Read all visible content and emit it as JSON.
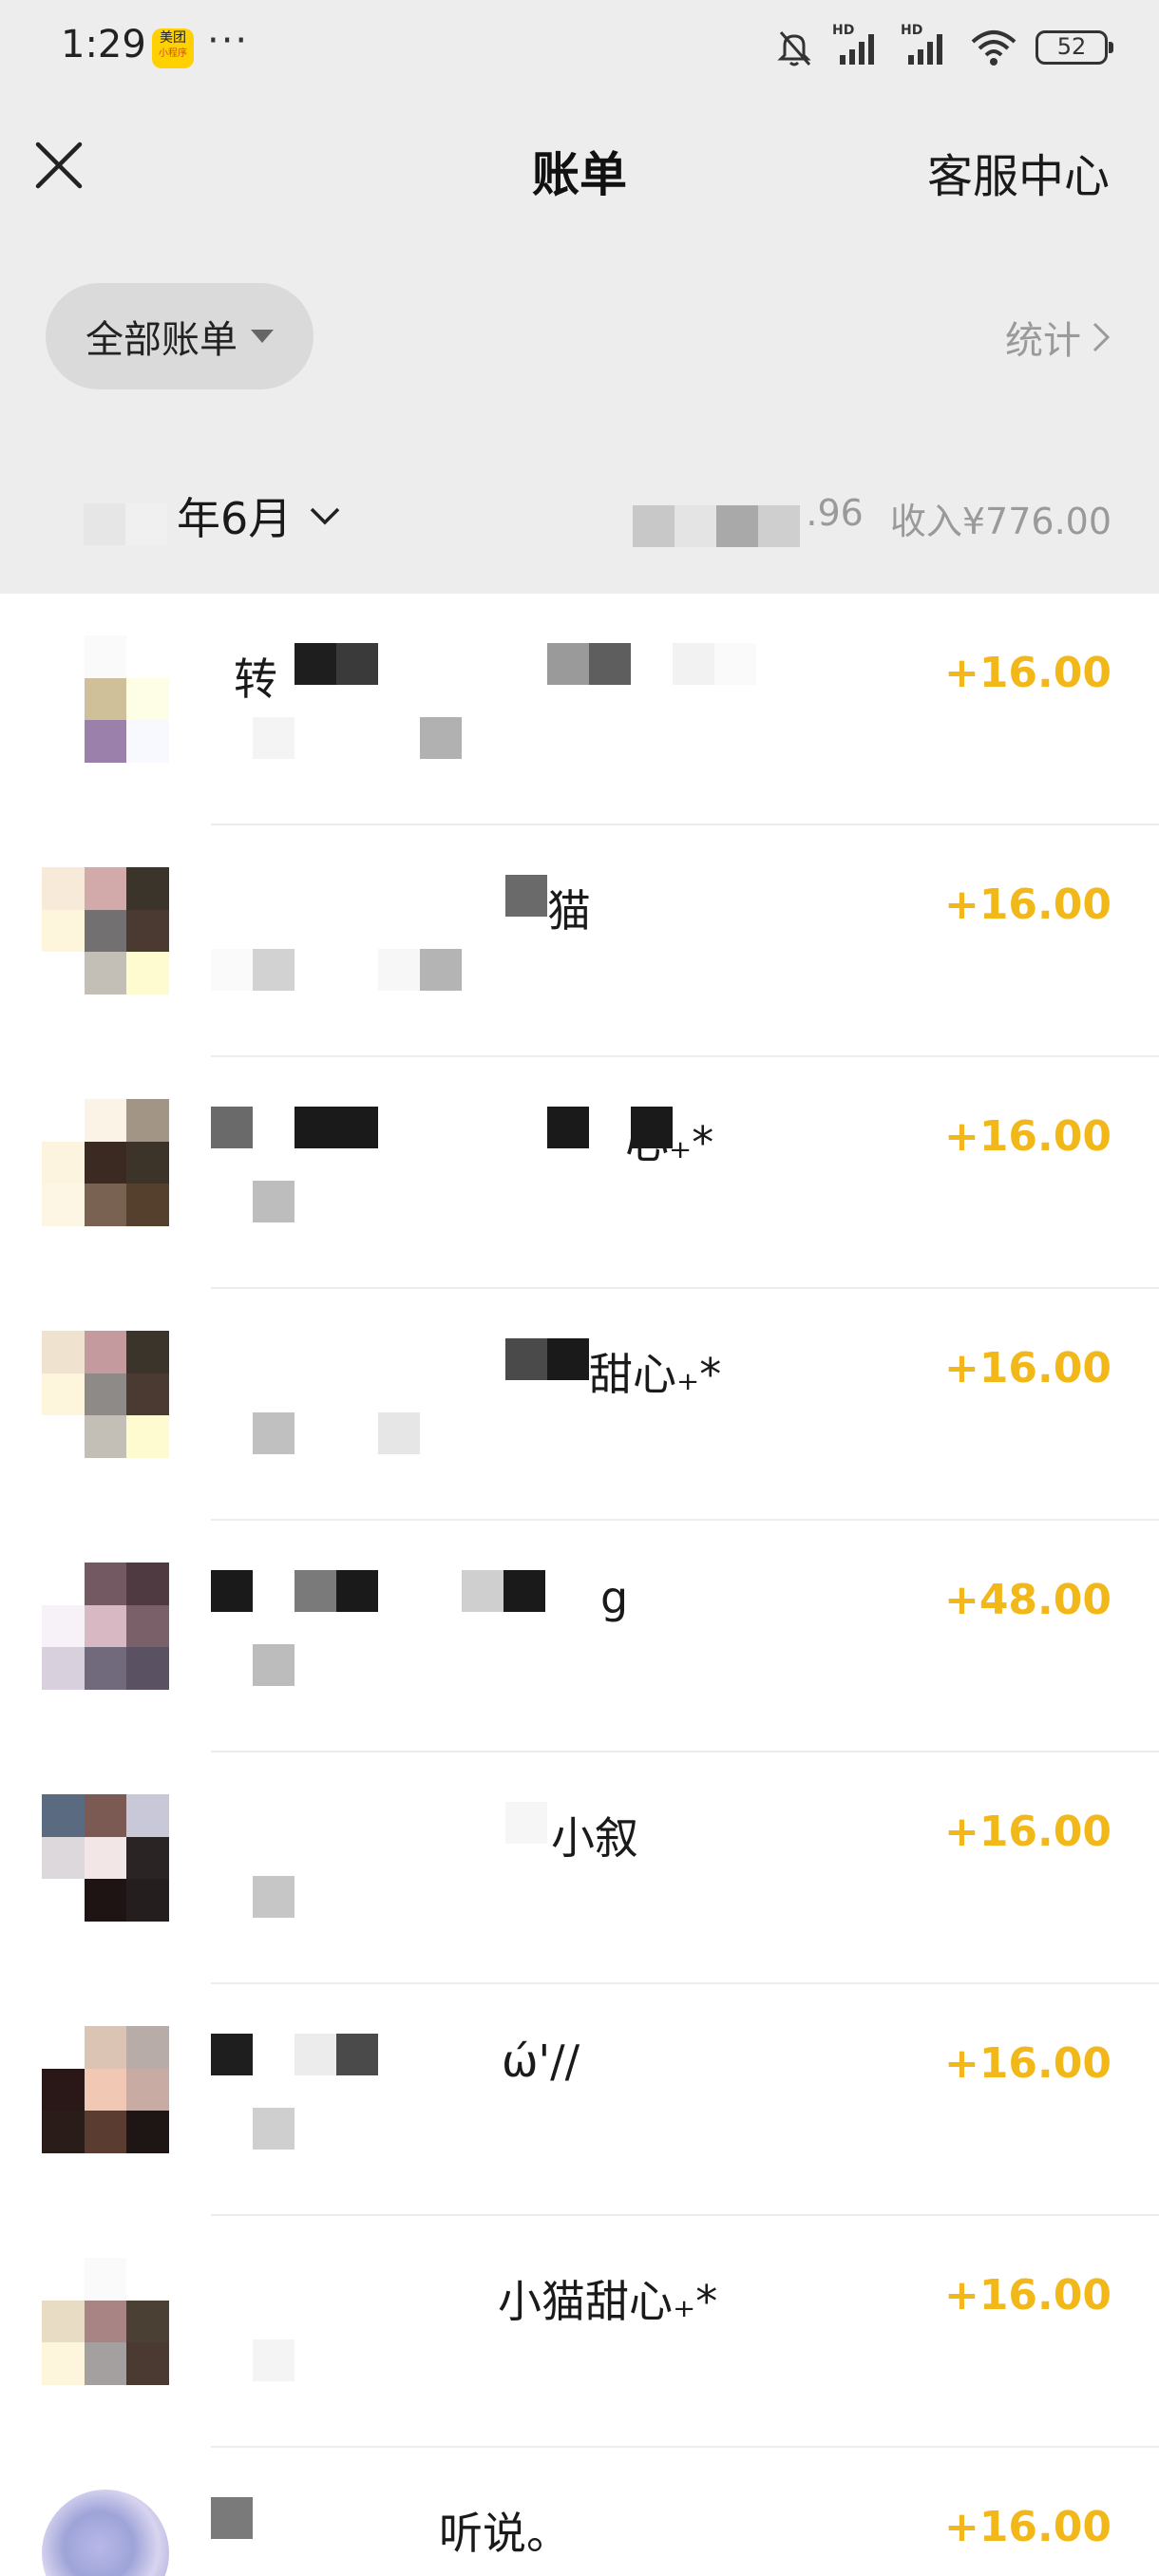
{
  "status_bar": {
    "time": "1:29",
    "app_badge": "美团",
    "app_badge_sub": "小程序",
    "more": "···",
    "network_1": "HD",
    "network_2": "HD",
    "battery": "52"
  },
  "nav": {
    "title": "账单",
    "service_center": "客服中心"
  },
  "filter": {
    "all_bills": "全部账单",
    "stats": "统计"
  },
  "month": {
    "label": "年6月",
    "expense_partial": ".96",
    "income": "收入¥776.00"
  },
  "bills": [
    {
      "title": "转",
      "amount": "+16.00"
    },
    {
      "title": "猫",
      "amount": "+16.00"
    },
    {
      "title": "心₊*",
      "amount": "+16.00"
    },
    {
      "title": "甜心₊*",
      "amount": "+16.00"
    },
    {
      "title": "g",
      "amount": "+48.00"
    },
    {
      "title": "小叙",
      "amount": "+16.00"
    },
    {
      "title": "ώ'//",
      "amount": "+16.00"
    },
    {
      "title": "小猫甜心₊*",
      "amount": "+16.00"
    },
    {
      "title": "听说。",
      "amount": "+16.00"
    }
  ],
  "colors": {
    "background": "#ededed",
    "amount": "#f2b81a",
    "text": "#1a1a1a",
    "muted": "#9a9a9a"
  }
}
